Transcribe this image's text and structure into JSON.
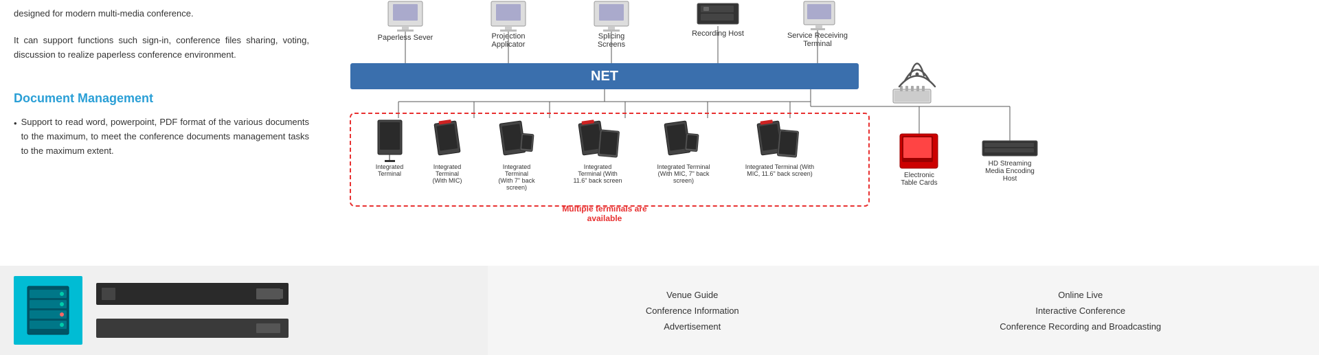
{
  "left_panel": {
    "intro_text": "designed for modern multi-media conference.",
    "intro_text2": "It can support functions such sign-in, conference files sharing, voting, discussion to realize paperless conference environment.",
    "doc_management_title": "Document Management",
    "bullet_text": "Support to read word, powerpoint, PDF format of the various documents to the maximum, to meet the conference documents management tasks to the maximum extent."
  },
  "diagram": {
    "net_label": "NET",
    "top_devices": [
      {
        "label": "Paperless Sever"
      },
      {
        "label": "Projection\nApplicator"
      },
      {
        "label": "Splicing\nScreens"
      },
      {
        "label": "Recording Host"
      },
      {
        "label": "Service Receiving\nTerminal"
      }
    ],
    "terminals": [
      {
        "label": "Integrated\nTerminal"
      },
      {
        "label": "Integrated\nTerminal\n(With MIC)"
      },
      {
        "label": "Integrated\nTerminal\n(With 7\" back\nscreen)"
      },
      {
        "label": "Integrated\nTerminal\n(With\n11.6\" back screen"
      },
      {
        "label": "Integrated Terminal\n(With MIC, 7\" back\nscreen)"
      },
      {
        "label": "Integrated Terminal (With\nMIC, 11.6\" back screen)"
      }
    ],
    "multiple_terminals_text": "Multiple terminals are\navailable",
    "right_devices": [
      {
        "label": "Electronic\nTable Cards"
      },
      {
        "label": "HD Streaming\nMedia Encoding\nHost"
      }
    ]
  },
  "footer": {
    "left_links": [
      "Venue Guide",
      "Conference Information",
      "Advertisement"
    ],
    "right_links": [
      "Online Live",
      "Interactive Conference",
      "Conference Recording and Broadcasting"
    ]
  },
  "colors": {
    "net_bar": "#3a6fad",
    "teal": "#00bcd4",
    "red_dashed": "#e83030",
    "blue_text": "#2a9fd6",
    "red_text": "#e83030"
  }
}
